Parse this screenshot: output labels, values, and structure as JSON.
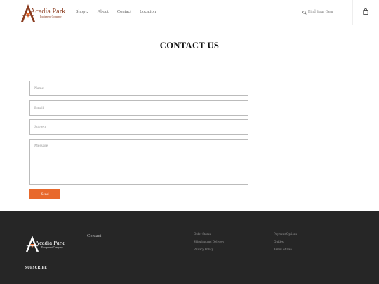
{
  "header": {
    "brand": "Acadia Park",
    "brand_sub": "Equipment Company",
    "nav": [
      {
        "label": "Shop"
      },
      {
        "label": "About"
      },
      {
        "label": "Contact"
      },
      {
        "label": "Location"
      }
    ],
    "search_placeholder": "Find Your Gear",
    "cart_icon": "shopping-bag-icon"
  },
  "main": {
    "title": "CONTACT US",
    "form": {
      "name_placeholder": "Name",
      "email_placeholder": "Email",
      "subject_placeholder": "Subject",
      "message_placeholder": "Message",
      "send_label": "Send"
    }
  },
  "footer": {
    "brand": "Acadia Park",
    "brand_sub": "Equipment Company",
    "contact_label": "Contact",
    "col1": [
      "Order Status",
      "Shipping and Delivery",
      "Privacy Policy"
    ],
    "col2": [
      "Payment Options",
      "Guides",
      "Terms of Use"
    ],
    "subscribe_label": "SUBSCRIBE"
  },
  "colors": {
    "accent": "#e8692c",
    "brand": "#8a3b1e",
    "footer_bg": "#262626"
  }
}
